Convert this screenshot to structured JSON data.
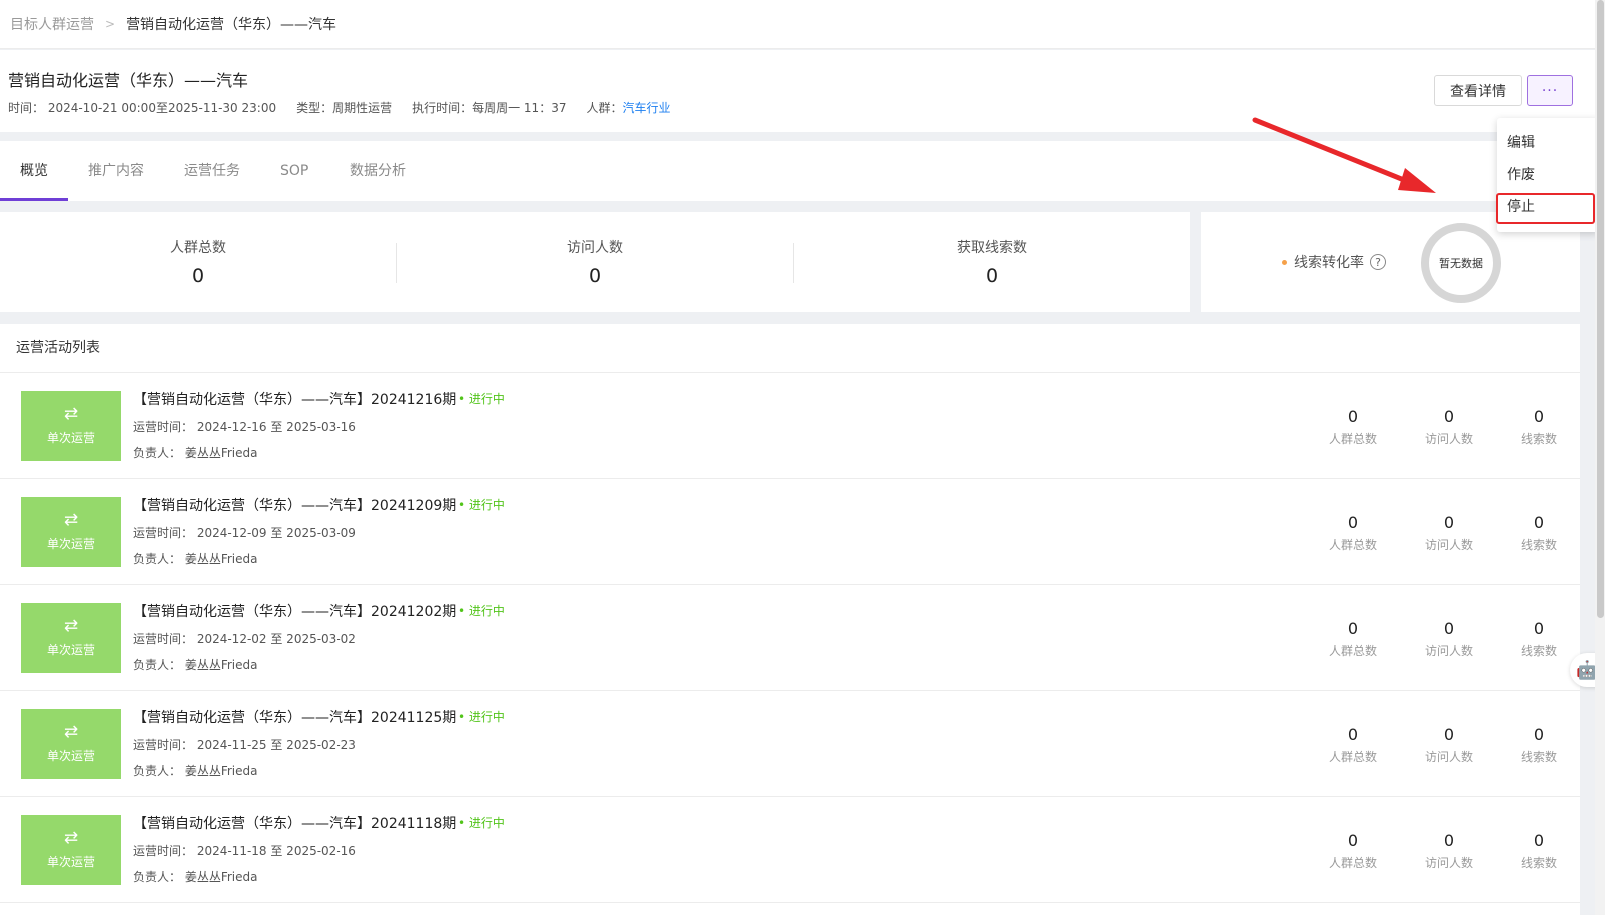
{
  "breadcrumb": {
    "parent": "目标人群运营",
    "separator": ">",
    "current": "营销自动化运营（华东）——汽车"
  },
  "header": {
    "title": "营销自动化运营（华东）——汽车",
    "time": "时间：  2024-10-21 00:00至2025-11-30 23:00",
    "type": "类型：周期性运营",
    "exec_time": "执行时间：每周周一   11：37",
    "crowd_label": "人群：",
    "crowd_link": "汽车行业",
    "detail_button": "查看详情",
    "more_button": "···"
  },
  "tabs": [
    "概览",
    "推广内容",
    "运营任务",
    "SOP",
    "数据分析"
  ],
  "stats": [
    {
      "label": "人群总数",
      "value": "0"
    },
    {
      "label": "访问人数",
      "value": "0"
    },
    {
      "label": "获取线索数",
      "value": "0"
    }
  ],
  "conversion": {
    "label": "线索转化率",
    "help": "?",
    "empty": "暂无数据"
  },
  "list": {
    "title": "运营活动列表",
    "thumb_icon": "⇄",
    "thumb_label": "单次运营",
    "stat_labels": [
      "人群总数",
      "访问人数",
      "线索数"
    ],
    "rows": [
      {
        "title": "【营销自动化运营（华东）——汽车】20241216期",
        "status": "• 进行中",
        "time": "运营时间：   2024-12-16 至 2025-03-16",
        "owner": "负责人：   姜丛丛Frieda",
        "values": [
          "0",
          "0",
          "0"
        ]
      },
      {
        "title": "【营销自动化运营（华东）——汽车】20241209期",
        "status": "• 进行中",
        "time": "运营时间：   2024-12-09 至 2025-03-09",
        "owner": "负责人：   姜丛丛Frieda",
        "values": [
          "0",
          "0",
          "0"
        ]
      },
      {
        "title": "【营销自动化运营（华东）——汽车】20241202期",
        "status": "• 进行中",
        "time": "运营时间：   2024-12-02 至 2025-03-02",
        "owner": "负责人：   姜丛丛Frieda",
        "values": [
          "0",
          "0",
          "0"
        ]
      },
      {
        "title": "【营销自动化运营（华东）——汽车】20241125期",
        "status": "• 进行中",
        "time": "运营时间：   2024-11-25 至 2025-02-23",
        "owner": "负责人：   姜丛丛Frieda",
        "values": [
          "0",
          "0",
          "0"
        ]
      },
      {
        "title": "【营销自动化运营（华东）——汽车】20241118期",
        "status": "• 进行中",
        "time": "运营时间：   2024-11-18 至 2025-02-16",
        "owner": "负责人：   姜丛丛Frieda",
        "values": [
          "0",
          "0",
          "0"
        ]
      }
    ]
  },
  "dropdown": {
    "items": [
      "编辑",
      "作废",
      "停止"
    ],
    "highlighted": "停止"
  },
  "colors": {
    "accent": "#6f3fd6",
    "link": "#1d7ff0",
    "status_green": "#52c41a",
    "thumb_green": "#95d96b",
    "annotation_red": "#e8282b"
  },
  "icons": {
    "thumb": "swap-arrows-icon",
    "assistant": "robot-icon",
    "annotation": "red-arrow-icon"
  }
}
